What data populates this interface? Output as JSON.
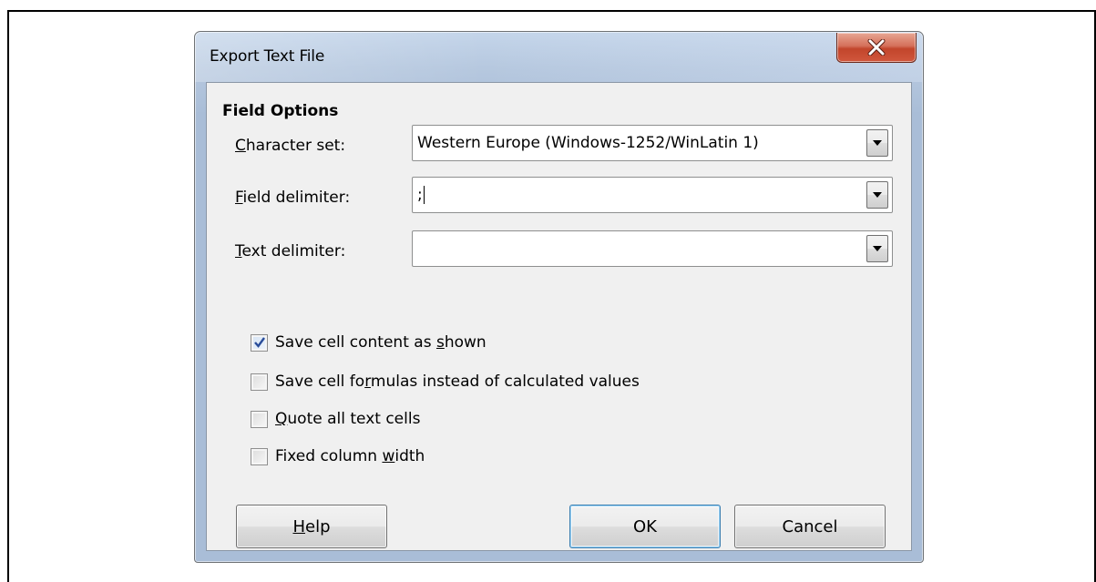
{
  "window": {
    "title": "Export Text File"
  },
  "field_options": {
    "section_title": "Field Options",
    "character_set": {
      "label_mnemonic": "C",
      "label_rest": "haracter set:",
      "value": "Western Europe (Windows-1252/WinLatin 1)"
    },
    "field_delimiter": {
      "label_mnemonic": "F",
      "label_rest": "ield delimiter:",
      "value": ";"
    },
    "text_delimiter": {
      "label_mnemonic": "T",
      "label_rest": "ext delimiter:",
      "value": ""
    }
  },
  "checkboxes": [
    {
      "before": "Save cell content as ",
      "mnemonic": "s",
      "after": "hown",
      "checked": true
    },
    {
      "before": "Save cell fo",
      "mnemonic": "r",
      "after": "mulas instead of calculated values",
      "checked": false
    },
    {
      "before": "",
      "mnemonic": "Q",
      "after": "uote all text cells",
      "checked": false
    },
    {
      "before": "Fixed column ",
      "mnemonic": "w",
      "after": "idth",
      "checked": false
    }
  ],
  "buttons": {
    "help_mnemonic": "H",
    "help_rest": "elp",
    "ok": "OK",
    "cancel": "Cancel"
  },
  "colors": {
    "title_bar": "#b6c8df",
    "close_button": "#c2452b",
    "dialog_body": "#f0f0f0",
    "checkmark": "#2a4d9a"
  },
  "icons": {
    "close": "close-icon",
    "dropdown": "chevron-down-icon",
    "check": "check-icon"
  }
}
